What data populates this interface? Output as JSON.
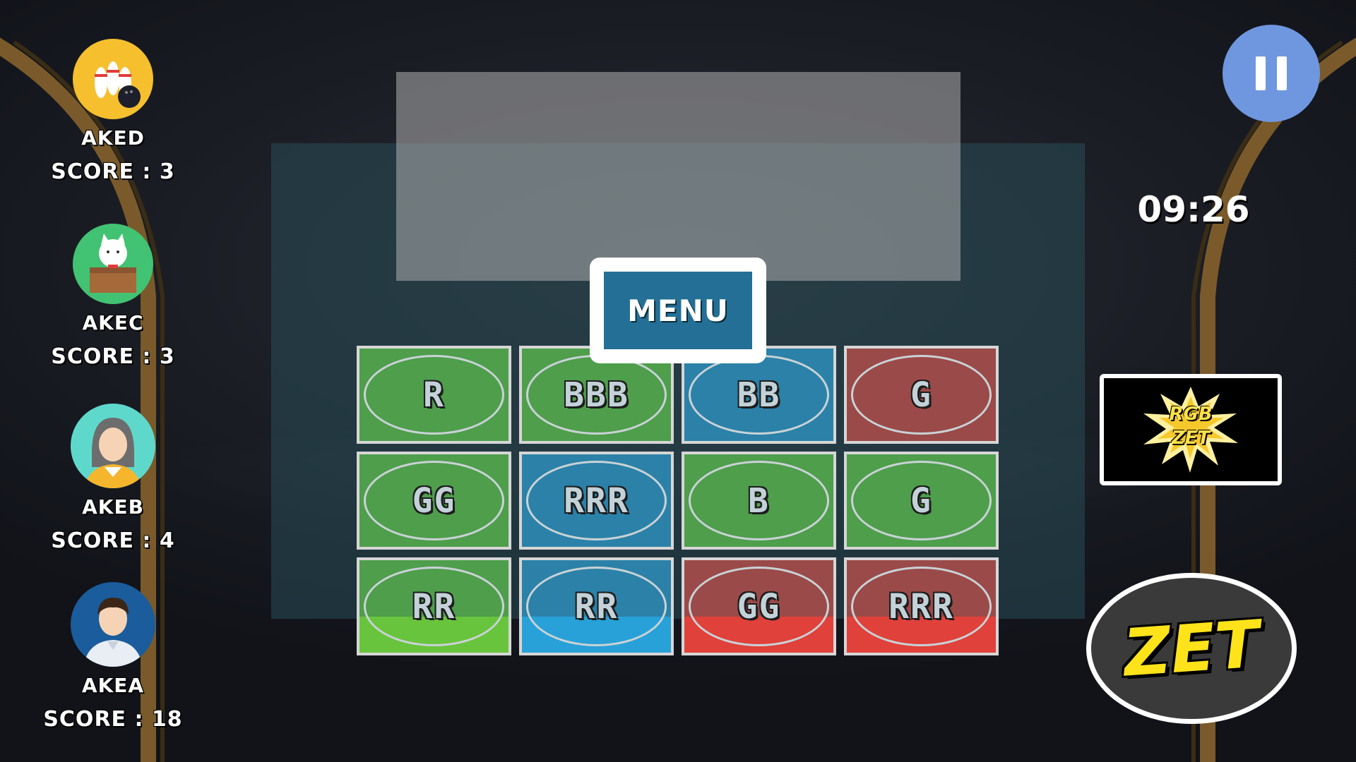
{
  "players": [
    {
      "name": "AKED",
      "score": "SCORE : 3",
      "avatar": "bowling-pins-icon",
      "color": "#f5bf2e"
    },
    {
      "name": "AKEC",
      "score": "SCORE : 3",
      "avatar": "lucky-cat-icon",
      "color": "#42c273"
    },
    {
      "name": "AKEB",
      "score": "SCORE : 4",
      "avatar": "woman-avatar-icon",
      "color": "#5fd8cc"
    },
    {
      "name": "AKEA",
      "score": "SCORE : 18",
      "avatar": "man-avatar-icon",
      "color": "#1b5c9c"
    }
  ],
  "timer": "09:26",
  "pause_icon": "pause-icon",
  "menu_label": "MENU",
  "cards": [
    {
      "symbol": "R",
      "color": "green"
    },
    {
      "symbol": "BBB",
      "color": "green"
    },
    {
      "symbol": "BB",
      "color": "blue"
    },
    {
      "symbol": "G",
      "color": "red"
    },
    {
      "symbol": "GG",
      "color": "green"
    },
    {
      "symbol": "RRR",
      "color": "blue"
    },
    {
      "symbol": "B",
      "color": "green"
    },
    {
      "symbol": "G",
      "color": "green"
    },
    {
      "symbol": "RR",
      "color": "green"
    },
    {
      "symbol": "RR",
      "color": "blue"
    },
    {
      "symbol": "GG",
      "color": "red"
    },
    {
      "symbol": "RRR",
      "color": "red"
    }
  ],
  "colors": {
    "green_dim": "#4e9e4b",
    "green_bright": "#68c43c",
    "blue_dim": "#2b81a8",
    "blue_bright": "#28a1d8",
    "red_dim": "#9a4a48",
    "red_bright": "#e0413a"
  },
  "logo": {
    "line1": "RGB",
    "line2": "ZET"
  },
  "zet_label": "ZET"
}
